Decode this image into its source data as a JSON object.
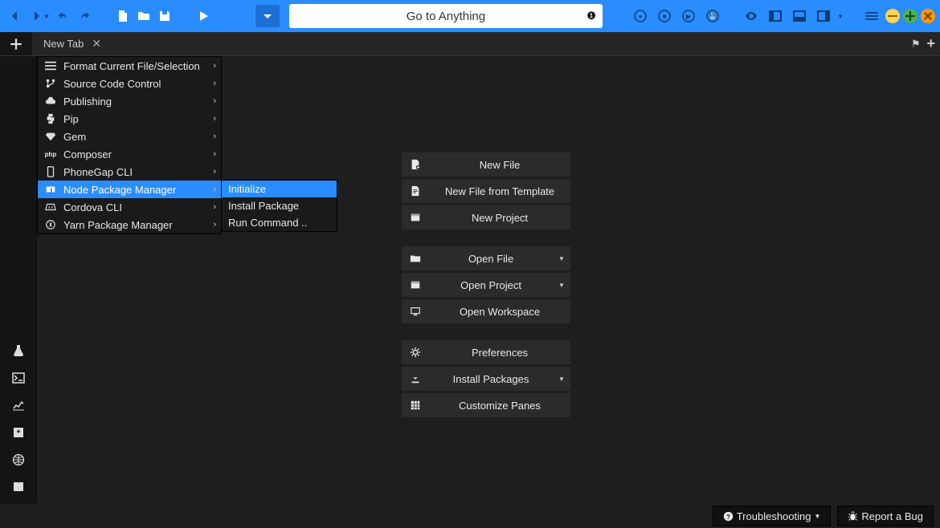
{
  "toolbar": {
    "search_placeholder": "Go to Anything"
  },
  "tab": {
    "new_tab": "New Tab"
  },
  "ctx_menu": {
    "items": [
      {
        "label": "Format Current File/Selection"
      },
      {
        "label": "Source Code Control"
      },
      {
        "label": "Publishing"
      },
      {
        "label": "Pip"
      },
      {
        "label": "Gem"
      },
      {
        "label": "Composer"
      },
      {
        "label": "PhoneGap CLI"
      },
      {
        "label": "Node Package Manager"
      },
      {
        "label": "Cordova CLI"
      },
      {
        "label": "Yarn Package Manager"
      }
    ],
    "submenu": [
      {
        "label": "Initialize"
      },
      {
        "label": "Install Package"
      },
      {
        "label": "Run Command .."
      }
    ]
  },
  "start": {
    "new_file": "New File",
    "new_file_template": "New File from Template",
    "new_project": "New Project",
    "open_file": "Open File",
    "open_project": "Open Project",
    "open_workspace": "Open Workspace",
    "preferences": "Preferences",
    "install_packages": "Install Packages",
    "customize_panes": "Customize Panes"
  },
  "status": {
    "troubleshooting": "Troubleshooting",
    "report_bug": "Report a Bug"
  }
}
